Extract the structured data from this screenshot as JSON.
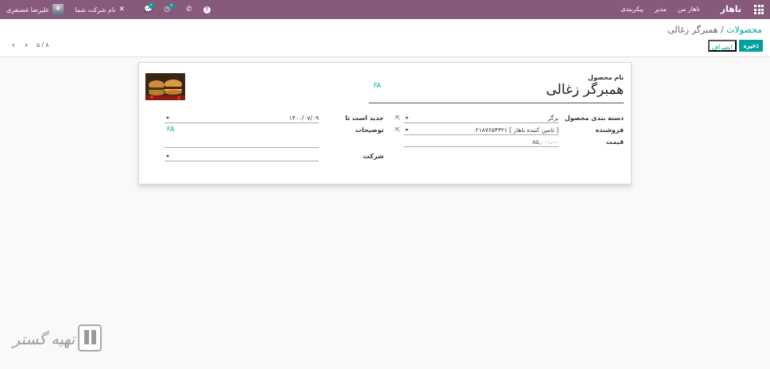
{
  "navbar": {
    "brand": "ناهار",
    "menu": [
      "ناهار من",
      "مدیر",
      "پیکربندی"
    ],
    "user_name": "علیرضا غضنفری",
    "company_name": "نام شرکت شما",
    "chat_badge": "۲",
    "activity_badge": "۹",
    "help_glyph": "?"
  },
  "breadcrumb": {
    "parent": "محصولات",
    "separator": "/",
    "current": "همبرگر زغالی"
  },
  "buttons": {
    "save": "ذخیره",
    "discard": "انصراف"
  },
  "pager": {
    "value": "۵ / ۸"
  },
  "form": {
    "name_label": "نام محصول",
    "name_value": "همبرگر زغالی",
    "lang_tag": "FA",
    "category_label": "دسته بندی محصول",
    "category_value": "برگر",
    "vendor_label": "فروشنده",
    "vendor_value": "[ تامین کننده ناهار ] ۰۲۱۸۷۶۵۴۳۲۱",
    "price_label": "قیمت",
    "price_value": "۸۵,۰۰۰.۰۰",
    "new_until_label": "جدید است تا",
    "new_until_value": "۱۴۰۰/۰۷/۰۹",
    "description_label": "توضیحات",
    "description_lang_tag": "FA",
    "company_label": "شرکت"
  },
  "watermark": "تهیه گستر"
}
